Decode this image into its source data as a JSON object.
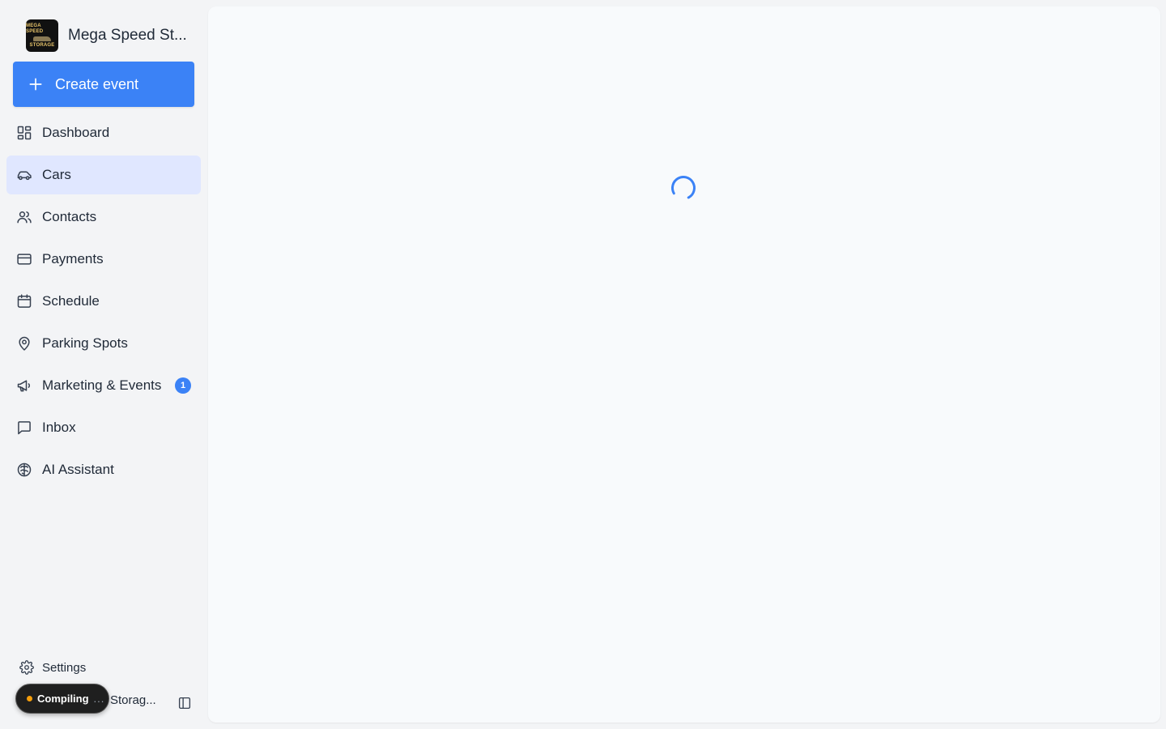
{
  "brand": {
    "name": "Mega Speed St...",
    "logo_text_top": "MEGA SPEED",
    "logo_text_bottom": "STORAGE"
  },
  "create_button": {
    "label": "Create event"
  },
  "nav": {
    "items": [
      {
        "label": "Dashboard",
        "icon": "dashboard-icon"
      },
      {
        "label": "Cars",
        "icon": "car-icon",
        "active": true
      },
      {
        "label": "Contacts",
        "icon": "users-icon"
      },
      {
        "label": "Payments",
        "icon": "credit-card-icon"
      },
      {
        "label": "Schedule",
        "icon": "calendar-icon"
      },
      {
        "label": "Parking Spots",
        "icon": "map-pin-icon"
      },
      {
        "label": "Marketing & Events",
        "icon": "megaphone-icon",
        "badge": "1"
      },
      {
        "label": "Inbox",
        "icon": "message-square-icon"
      },
      {
        "label": "AI Assistant",
        "icon": "brain-icon"
      }
    ]
  },
  "settings": {
    "label": "Settings",
    "icon": "gear-icon"
  },
  "account": {
    "label": "Storag..."
  },
  "compiling": {
    "label": "Compiling",
    "dots": "..."
  },
  "colors": {
    "accent": "#3b82f6",
    "active_bg": "#e0e7ff",
    "sidebar_bg": "#f3f4f6",
    "main_bg": "#f8fafc",
    "status_dot": "#f59e0b"
  }
}
